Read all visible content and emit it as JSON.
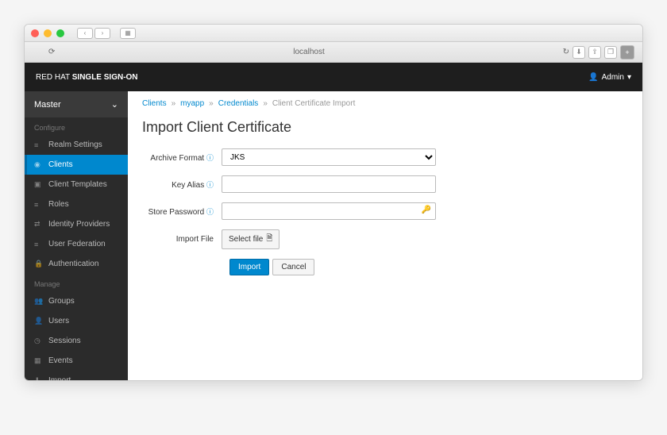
{
  "browser": {
    "url": "localhost"
  },
  "header": {
    "brand_light": "RED HAT ",
    "brand_bold": "SINGLE SIGN-ON",
    "user": "Admin"
  },
  "sidebar": {
    "realm": "Master",
    "configure_label": "Configure",
    "manage_label": "Manage",
    "configure": [
      "Realm Settings",
      "Clients",
      "Client Templates",
      "Roles",
      "Identity Providers",
      "User Federation",
      "Authentication"
    ],
    "manage": [
      "Groups",
      "Users",
      "Sessions",
      "Events",
      "Import"
    ]
  },
  "breadcrumb": [
    "Clients",
    "myapp",
    "Credentials",
    "Client Certificate Import"
  ],
  "page": {
    "title": "Import Client Certificate",
    "archive_label": "Archive Format",
    "archive_value": "JKS",
    "alias_label": "Key Alias",
    "alias_value": "",
    "password_label": "Store Password",
    "password_value": "",
    "file_label": "Import File",
    "file_button": "Select file",
    "import_btn": "Import",
    "cancel_btn": "Cancel"
  }
}
